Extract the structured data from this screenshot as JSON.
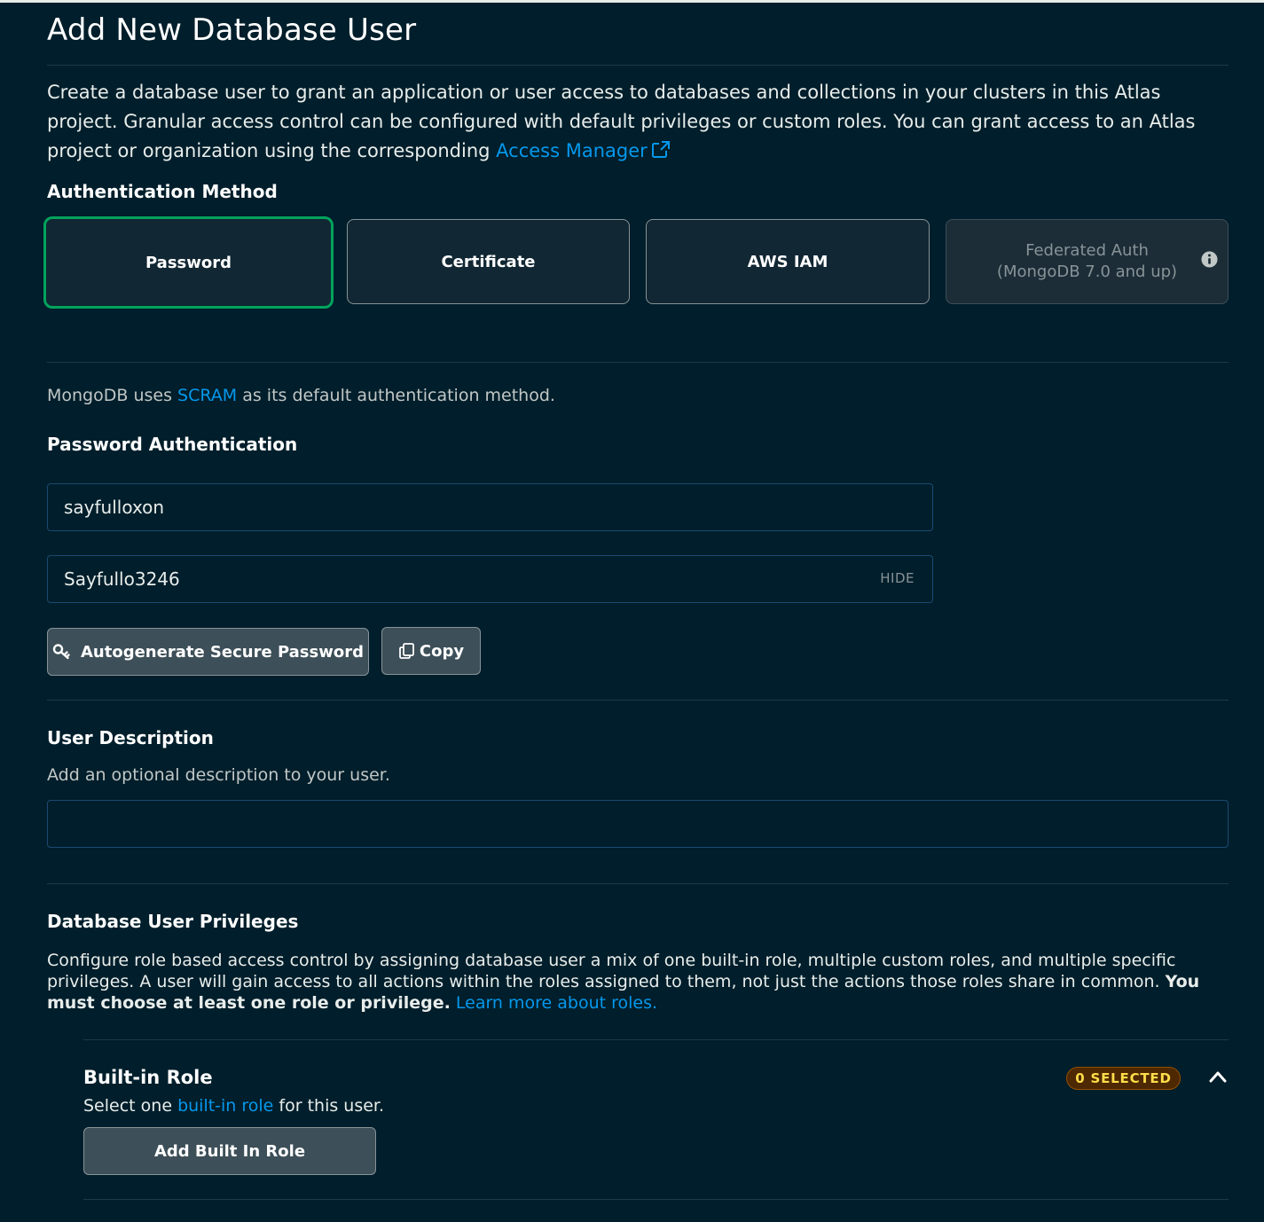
{
  "page": {
    "title": "Add New Database User",
    "intro_text": "Create a database user to grant an application or user access to databases and collections in your clusters in this Atlas project. Granular access control can be configured with default privileges or custom roles. You can grant access to an Atlas project or organization using the corresponding ",
    "intro_link": "Access Manager"
  },
  "auth": {
    "heading": "Authentication Method",
    "options": [
      {
        "label": "Password",
        "state": "selected"
      },
      {
        "label": "Certificate",
        "state": "default"
      },
      {
        "label": "AWS IAM",
        "state": "default"
      },
      {
        "label": "Federated Auth",
        "sublabel": "(MongoDB 7.0 and up)",
        "state": "disabled"
      }
    ],
    "note_prefix": "MongoDB uses ",
    "note_link": "SCRAM",
    "note_suffix": " as its default authentication method."
  },
  "password_auth": {
    "heading": "Password Authentication",
    "username_value": "sayfulloxon",
    "password_value": "Sayfullo3246",
    "hide_label": "HIDE",
    "autogen_label": "Autogenerate Secure Password",
    "copy_label": "Copy"
  },
  "description": {
    "heading": "User Description",
    "help_text": "Add an optional description to your user.",
    "value": ""
  },
  "privileges": {
    "heading": "Database User Privileges",
    "text": "Configure role based access control by assigning database user a mix of one built-in role, multiple custom roles, and multiple specific privileges. A user will gain access to all actions within the roles assigned to them, not just the actions those roles share in common. ",
    "bold_text": "You must choose at least one role or privilege.",
    "link": "Learn more about roles."
  },
  "builtin_role": {
    "heading": "Built-in Role",
    "text_prefix": "Select one ",
    "text_link": "built-in role",
    "text_suffix": " for this user.",
    "badge": "0 SELECTED",
    "add_button": "Add Built In Role"
  },
  "colors": {
    "background": "#001e2b",
    "link": "#0498ec",
    "selected_border": "#00a35c",
    "badge_bg": "#4d2800",
    "badge_text": "#ffdd49"
  }
}
